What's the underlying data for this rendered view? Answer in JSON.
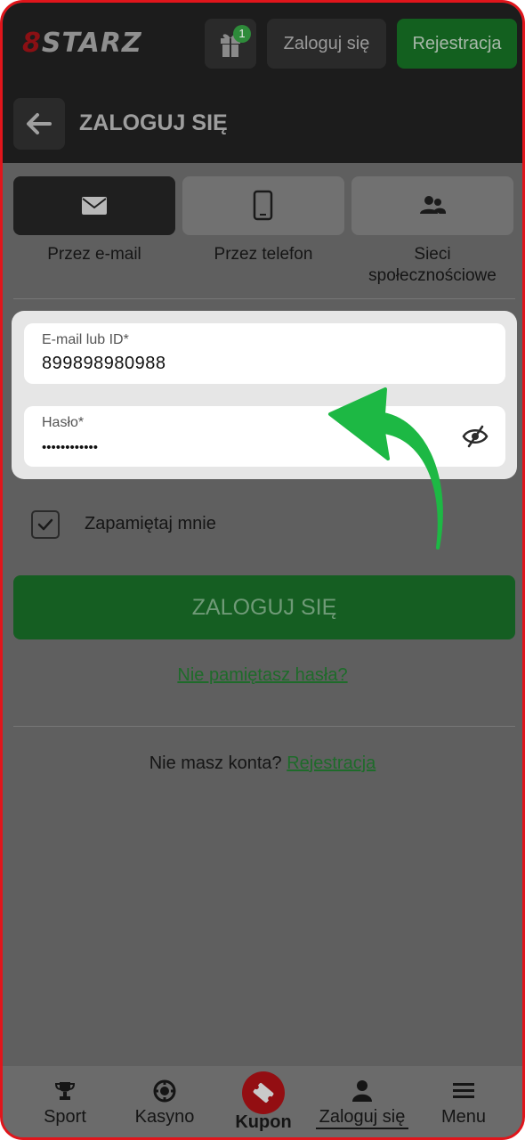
{
  "header": {
    "logo_prefix": "8",
    "logo_text": "STARZ",
    "gift_badge": "1",
    "login_label": "Zaloguj się",
    "register_label": "Rejestracja",
    "page_title": "ZALOGUJ SIĘ"
  },
  "methods": [
    {
      "label": "Przez e-mail",
      "icon": "envelope-icon",
      "active": true
    },
    {
      "label": "Przez telefon",
      "icon": "phone-icon",
      "active": false
    },
    {
      "label": "Sieci\nspołecznościowe",
      "icon": "users-icon",
      "active": false
    }
  ],
  "form": {
    "email_label": "E-mail lub ID*",
    "email_value": "899898980988",
    "password_label": "Hasło*",
    "password_value": "••••••••••••",
    "remember_label": "Zapamiętaj mnie",
    "remember_checked": true,
    "submit_label": "ZALOGUJ SIĘ",
    "forgot_label": "Nie pamiętasz hasła?",
    "no_account_text": "Nie masz konta?",
    "register_link": "Rejestracja"
  },
  "bottom_nav": [
    {
      "label": "Sport",
      "icon": "trophy-icon"
    },
    {
      "label": "Kasyno",
      "icon": "chip-icon"
    },
    {
      "label": "Kupon",
      "icon": "ticket-icon"
    },
    {
      "label": "Zaloguj się",
      "icon": "user-icon"
    },
    {
      "label": "Menu",
      "icon": "menu-icon"
    }
  ],
  "colors": {
    "accent_green": "#1db844",
    "frame_red": "#e0151b",
    "brand_green": "#155e22"
  }
}
